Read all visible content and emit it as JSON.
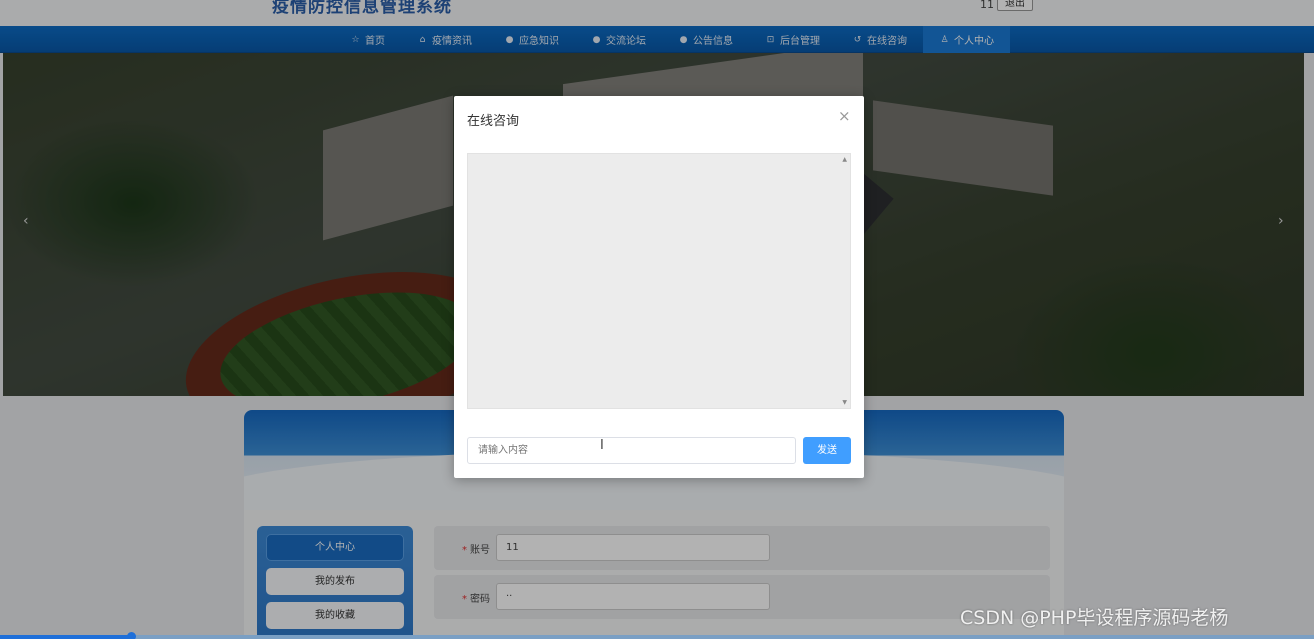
{
  "header": {
    "site_title": "疫情防控信息管理系统",
    "user_name": "11",
    "logout_label": "退出"
  },
  "nav": {
    "items": [
      {
        "icon": "star-icon",
        "glyph": "☆",
        "label": "首页"
      },
      {
        "icon": "bag-icon",
        "glyph": "⌂",
        "label": "疫情资讯"
      },
      {
        "icon": "info-icon",
        "glyph": "●",
        "label": "应急知识"
      },
      {
        "icon": "forum-icon",
        "glyph": "●",
        "label": "交流论坛"
      },
      {
        "icon": "notice-icon",
        "glyph": "●",
        "label": "公告信息"
      },
      {
        "icon": "admin-icon",
        "glyph": "⊡",
        "label": "后台管理"
      },
      {
        "icon": "chat-icon",
        "glyph": "↺",
        "label": "在线咨询"
      },
      {
        "icon": "user-icon",
        "glyph": "♙",
        "label": "个人中心"
      }
    ],
    "active_index": 7
  },
  "banner": {
    "prev_glyph": "‹",
    "next_glyph": "›"
  },
  "sidebar": {
    "items": [
      {
        "label": "个人中心"
      },
      {
        "label": "我的发布"
      },
      {
        "label": "我的收藏"
      }
    ]
  },
  "form": {
    "fields": [
      {
        "label": "账号",
        "required": "*",
        "value": "11"
      },
      {
        "label": "密码",
        "required": "*",
        "value": "··"
      }
    ]
  },
  "modal": {
    "title": "在线咨询",
    "close_glyph": "×",
    "input_placeholder": "请输入内容",
    "send_label": "发送",
    "text_cursor": "I"
  },
  "watermark": "CSDN @PHP毕设程序源码老杨",
  "progress": {
    "value": 0.1
  }
}
